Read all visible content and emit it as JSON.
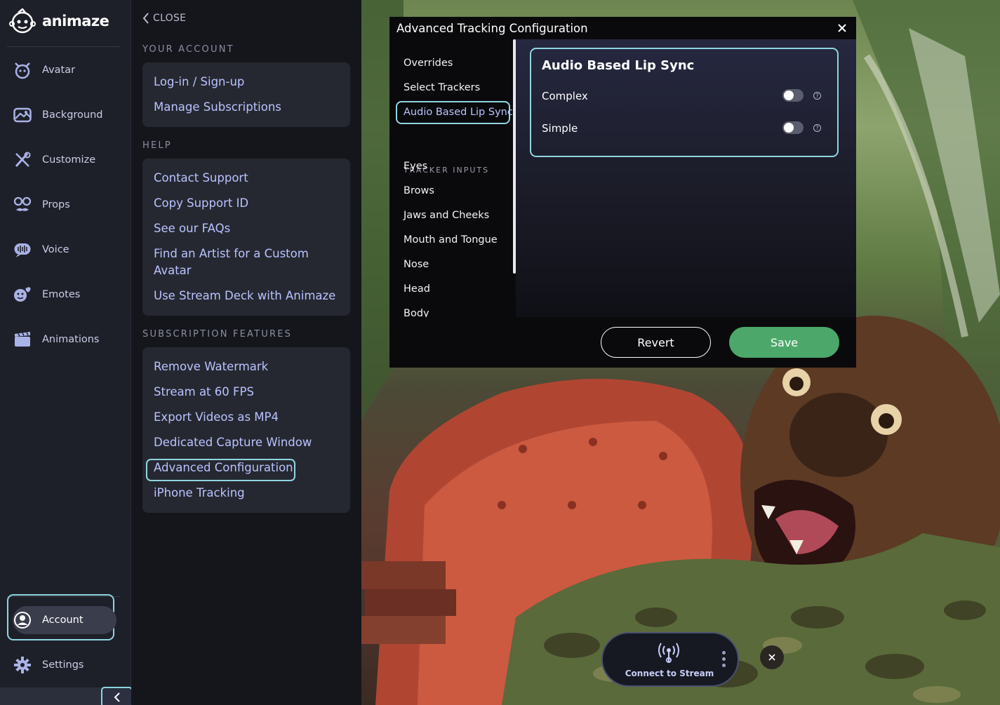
{
  "app": {
    "logo_text": "animaze"
  },
  "sidebar": {
    "items": [
      {
        "label": "Avatar",
        "icon": "avatar-icon"
      },
      {
        "label": "Background",
        "icon": "background-icon"
      },
      {
        "label": "Customize",
        "icon": "customize-icon"
      },
      {
        "label": "Props",
        "icon": "props-icon"
      },
      {
        "label": "Voice",
        "icon": "voice-icon"
      },
      {
        "label": "Emotes",
        "icon": "emotes-icon"
      },
      {
        "label": "Animations",
        "icon": "animations-icon"
      }
    ],
    "account_label": "Account",
    "settings_label": "Settings"
  },
  "account_panel": {
    "close_label": "CLOSE",
    "your_account": {
      "heading": "YOUR ACCOUNT",
      "links": [
        "Log-in / Sign-up",
        "Manage Subscriptions"
      ]
    },
    "help": {
      "heading": "HELP",
      "links": [
        "Contact Support",
        "Copy Support ID",
        "See our FAQs",
        "Find an Artist for a Custom",
        "Avatar",
        "Use Stream Deck with Animaze"
      ]
    },
    "subscription": {
      "heading": "SUBSCRIPTION FEATURES",
      "links": [
        "Remove Watermark",
        "Stream at 60 FPS",
        "Export Videos as MP4",
        "Dedicated Capture Window",
        "Advanced Configuration",
        "iPhone Tracking"
      ]
    }
  },
  "modal": {
    "title": "Advanced Tracking Configuration",
    "nav": {
      "items": [
        "Overrides",
        "Select Trackers",
        "Audio Based Lip Sync"
      ],
      "section_heading": "TRACKER INPUTS",
      "tracker_items": [
        "Eyes",
        "Brows",
        "Jaws and Cheeks",
        "Mouth and Tongue",
        "Nose",
        "Head",
        "Body"
      ]
    },
    "lip_sync": {
      "title": "Audio Based Lip Sync",
      "options": [
        {
          "label": "Complex",
          "enabled": false
        },
        {
          "label": "Simple",
          "enabled": false
        }
      ],
      "help_glyph": "?"
    },
    "revert_label": "Revert",
    "save_label": "Save"
  },
  "stream": {
    "label": "Connect to Stream"
  },
  "colors": {
    "accent_highlight": "#8fd5e0",
    "link": "#b9c3ff",
    "save": "#4ca86a",
    "sidebar_bg": "#1e2029",
    "panel_bg": "#15161c"
  }
}
